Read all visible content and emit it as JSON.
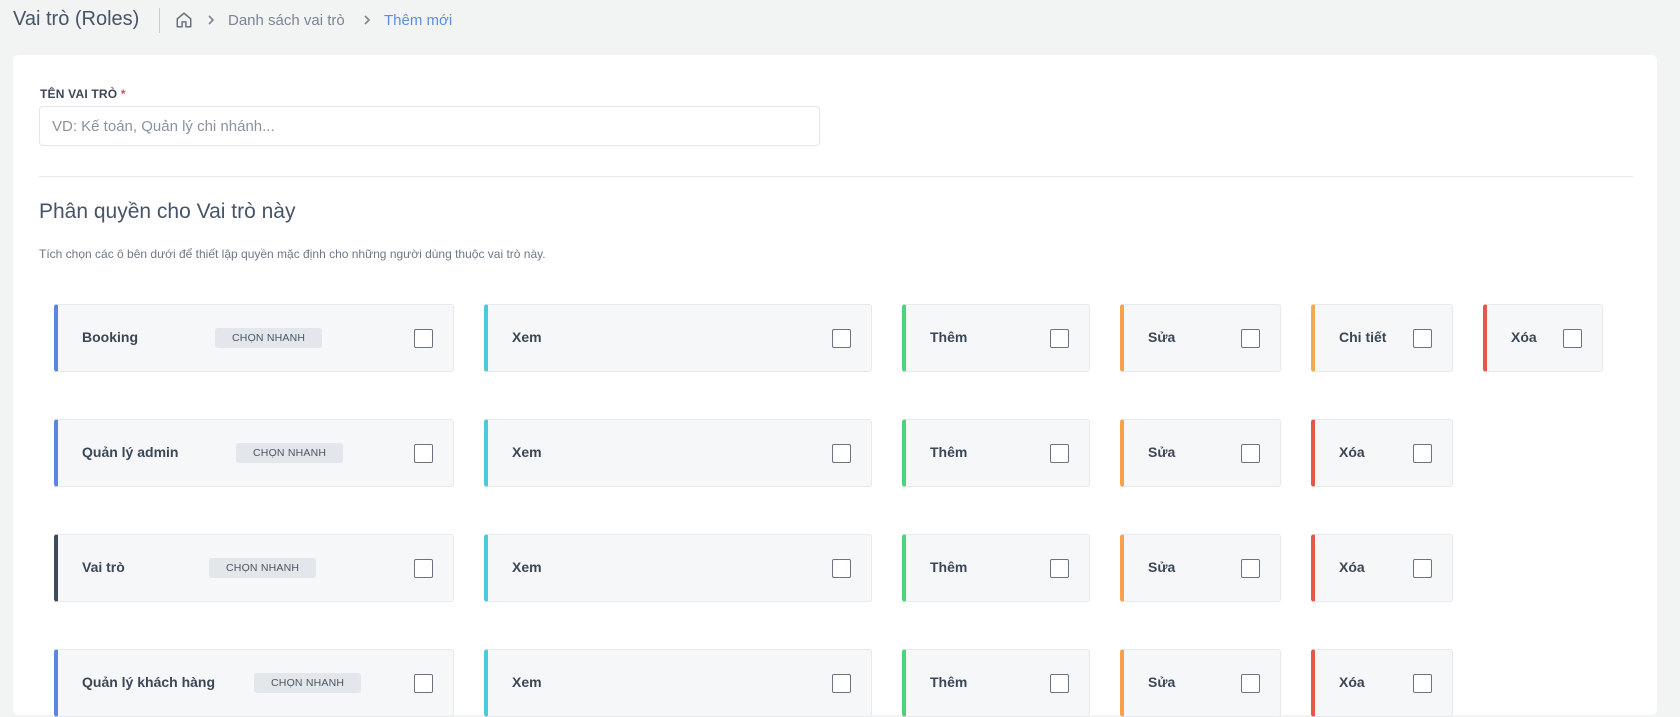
{
  "header": {
    "title": "Vai trò (Roles)",
    "breadcrumb": {
      "home_icon": "home-icon",
      "list": "Danh sách vai trò",
      "current": "Thêm mới"
    }
  },
  "form": {
    "name_label": "TÊN VAI TRÒ",
    "required_mark": "*",
    "name_placeholder": "VD: Kế toán, Quản lý chi nhánh...",
    "name_value": ""
  },
  "permissions": {
    "heading": "Phân quyền cho Vai trò này",
    "description": "Tích chọn các ô bên dưới để thiết lập quyền mặc định cho những người dùng thuộc vai trò này.",
    "quick_select_label": "CHỌN NHANH",
    "colors": {
      "module_blue": "#5b86e0",
      "module_dark": "#3f4a5a",
      "view": "#4ec9dc",
      "add": "#4cd37e",
      "edit": "#f5a24a",
      "detail": "#f0ad4e",
      "delete": "#e5574b"
    },
    "modules": [
      {
        "name": "Booking",
        "actions": [
          {
            "label": "Xem",
            "checked": false
          },
          {
            "label": "Thêm",
            "checked": false
          },
          {
            "label": "Sửa",
            "checked": false
          },
          {
            "label": "Chi tiết",
            "checked": false
          },
          {
            "label": "Xóa",
            "checked": false
          }
        ]
      },
      {
        "name": "Quản lý admin",
        "actions": [
          {
            "label": "Xem",
            "checked": false
          },
          {
            "label": "Thêm",
            "checked": false
          },
          {
            "label": "Sửa",
            "checked": false
          },
          {
            "label": "Xóa",
            "checked": false
          }
        ]
      },
      {
        "name": "Vai trò",
        "actions": [
          {
            "label": "Xem",
            "checked": false
          },
          {
            "label": "Thêm",
            "checked": false
          },
          {
            "label": "Sửa",
            "checked": false
          },
          {
            "label": "Xóa",
            "checked": false
          }
        ]
      },
      {
        "name": "Quản lý khách hàng",
        "actions": [
          {
            "label": "Xem",
            "checked": false
          },
          {
            "label": "Thêm",
            "checked": false
          },
          {
            "label": "Sửa",
            "checked": false
          },
          {
            "label": "Xóa",
            "checked": false
          }
        ]
      }
    ]
  }
}
